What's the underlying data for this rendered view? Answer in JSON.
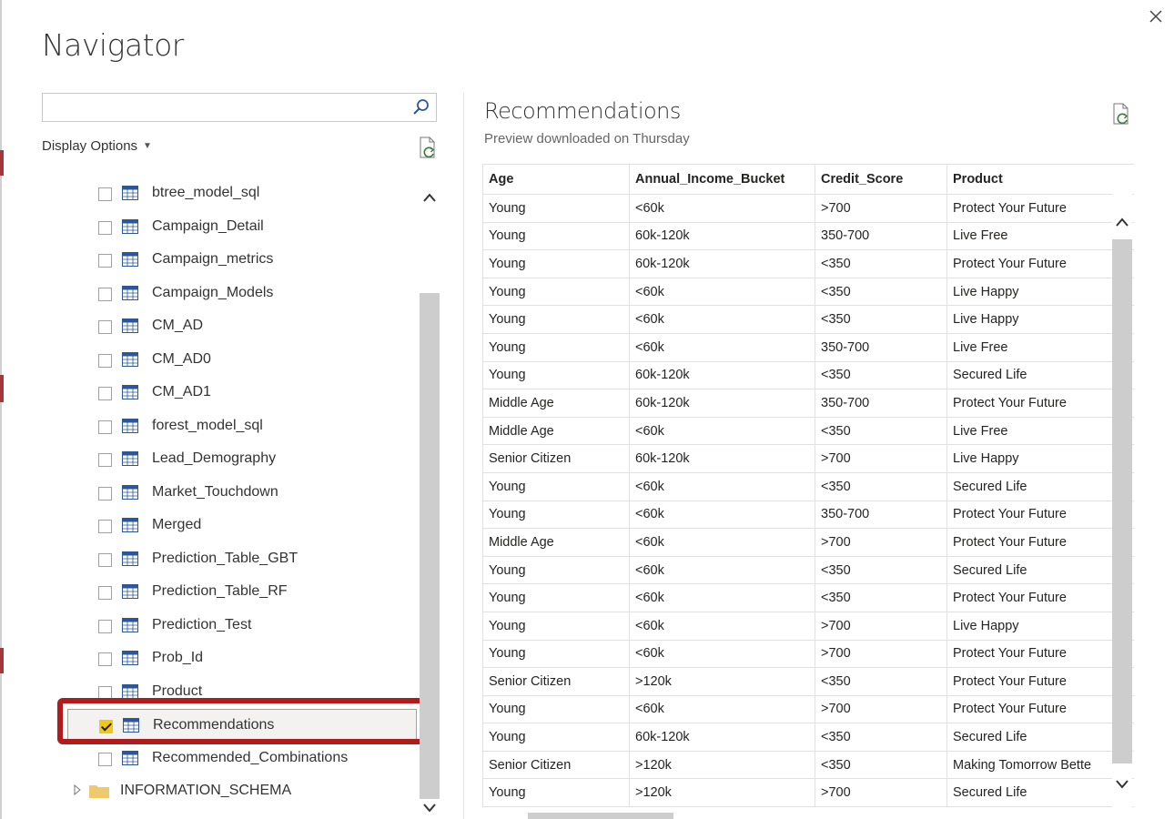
{
  "dialog": {
    "title": "Navigator",
    "close_icon": "close-icon"
  },
  "colors": {
    "accent_check": "#f2c811",
    "highlight": "#b01c1c",
    "table_icon": "#2b579a"
  },
  "search": {
    "value": "",
    "placeholder": ""
  },
  "display_options": {
    "label": "Display Options"
  },
  "tree": {
    "items": [
      {
        "label": "btree_model_sql",
        "checked": false
      },
      {
        "label": "Campaign_Detail",
        "checked": false
      },
      {
        "label": "Campaign_metrics",
        "checked": false
      },
      {
        "label": "Campaign_Models",
        "checked": false
      },
      {
        "label": "CM_AD",
        "checked": false
      },
      {
        "label": "CM_AD0",
        "checked": false
      },
      {
        "label": "CM_AD1",
        "checked": false
      },
      {
        "label": "forest_model_sql",
        "checked": false
      },
      {
        "label": "Lead_Demography",
        "checked": false
      },
      {
        "label": "Market_Touchdown",
        "checked": false
      },
      {
        "label": "Merged",
        "checked": false
      },
      {
        "label": "Prediction_Table_GBT",
        "checked": false
      },
      {
        "label": "Prediction_Table_RF",
        "checked": false
      },
      {
        "label": "Prediction_Test",
        "checked": false
      },
      {
        "label": "Prob_Id",
        "checked": false
      },
      {
        "label": "Product",
        "checked": false
      },
      {
        "label": "Recommendations",
        "checked": true
      },
      {
        "label": "Recommended_Combinations",
        "checked": false
      }
    ],
    "folder": {
      "label": "INFORMATION_SCHEMA"
    }
  },
  "preview": {
    "title": "Recommendations",
    "subtitle": "Preview downloaded on Thursday",
    "columns": [
      "Age",
      "Annual_Income_Bucket",
      "Credit_Score",
      "Product"
    ],
    "rows": [
      [
        "Young",
        "<60k",
        ">700",
        "Protect Your Future"
      ],
      [
        "Young",
        "60k-120k",
        "350-700",
        "Live Free"
      ],
      [
        "Young",
        "60k-120k",
        "<350",
        "Protect Your Future"
      ],
      [
        "Young",
        "<60k",
        "<350",
        "Live Happy"
      ],
      [
        "Young",
        "<60k",
        "<350",
        "Live Happy"
      ],
      [
        "Young",
        "<60k",
        "350-700",
        "Live Free"
      ],
      [
        "Young",
        "60k-120k",
        "<350",
        "Secured Life"
      ],
      [
        "Middle Age",
        "60k-120k",
        "350-700",
        "Protect Your Future"
      ],
      [
        "Middle Age",
        "<60k",
        "<350",
        "Live Free"
      ],
      [
        "Senior Citizen",
        "60k-120k",
        ">700",
        "Live Happy"
      ],
      [
        "Young",
        "<60k",
        "<350",
        "Secured Life"
      ],
      [
        "Young",
        "<60k",
        "350-700",
        "Protect Your Future"
      ],
      [
        "Middle Age",
        "<60k",
        ">700",
        "Protect Your Future"
      ],
      [
        "Young",
        "<60k",
        "<350",
        "Secured Life"
      ],
      [
        "Young",
        "<60k",
        "<350",
        "Protect Your Future"
      ],
      [
        "Young",
        "<60k",
        ">700",
        "Live Happy"
      ],
      [
        "Young",
        "<60k",
        ">700",
        "Protect Your Future"
      ],
      [
        "Senior Citizen",
        ">120k",
        "<350",
        "Protect Your Future"
      ],
      [
        "Young",
        "<60k",
        ">700",
        "Protect Your Future"
      ],
      [
        "Young",
        "60k-120k",
        "<350",
        "Secured Life"
      ],
      [
        "Senior Citizen",
        ">120k",
        "<350",
        "Making Tomorrow Bette"
      ],
      [
        "Young",
        ">120k",
        ">700",
        "Secured Life"
      ]
    ]
  }
}
